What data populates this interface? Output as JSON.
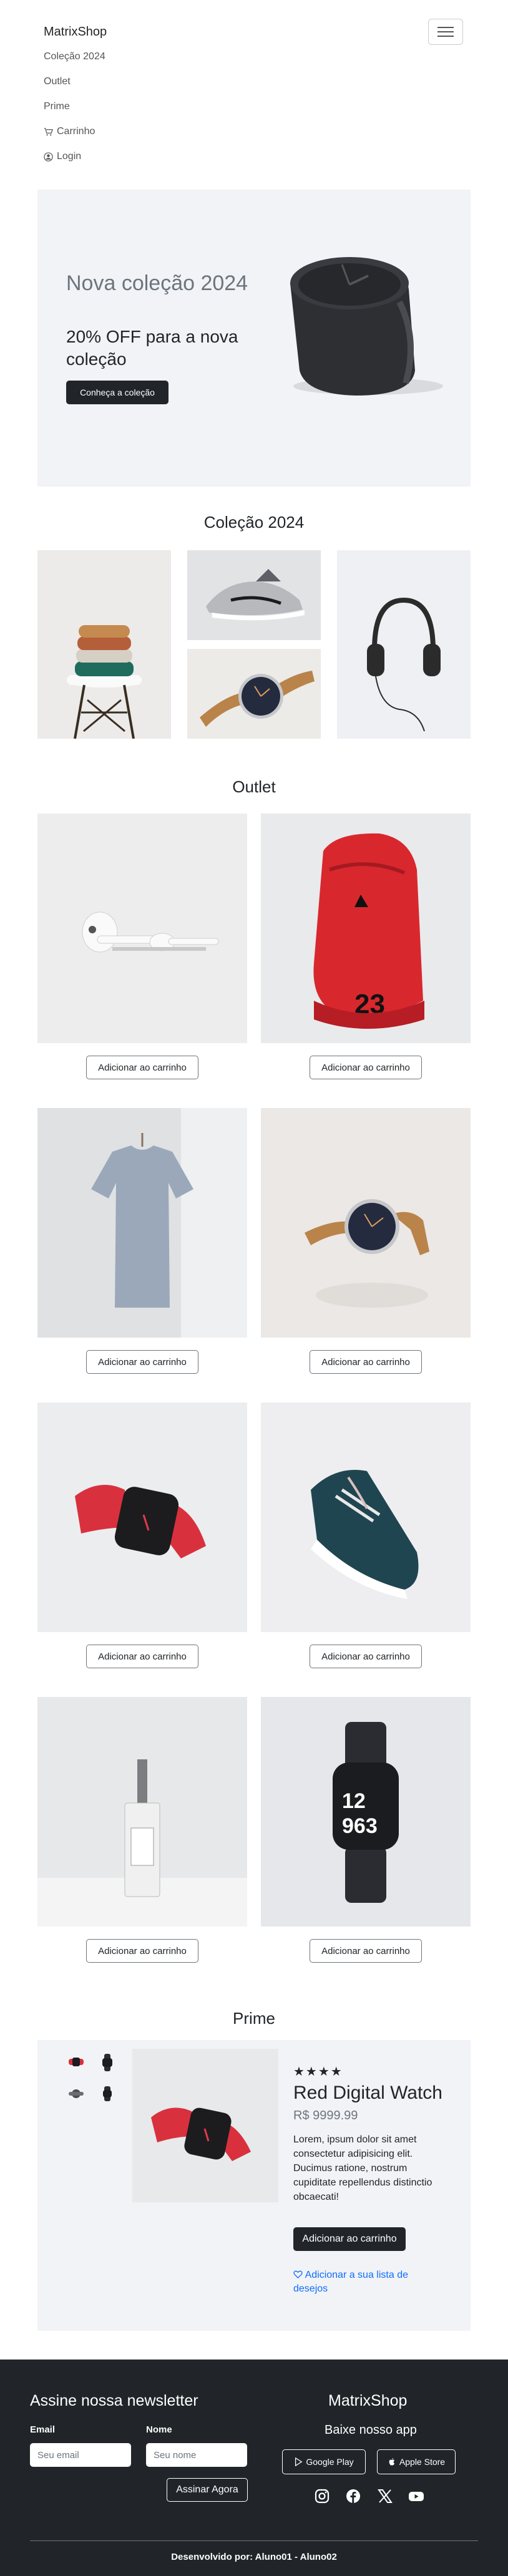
{
  "navbar": {
    "brand": "MatrixShop",
    "items": [
      {
        "label": "Coleção 2024"
      },
      {
        "label": "Outlet"
      },
      {
        "label": "Prime"
      },
      {
        "label": "Carrinho",
        "icon": "cart-icon"
      },
      {
        "label": "Login",
        "icon": "person-circle-icon"
      }
    ]
  },
  "hero": {
    "title": "Nova coleção 2024",
    "subtitle": "20% OFF para a nova coleção",
    "button": "Conheça a coleção"
  },
  "collection": {
    "title": "Coleção 2024"
  },
  "outlet": {
    "title": "Outlet",
    "products": [
      {
        "image": "earbuds",
        "button": "Adicionar ao carrinho"
      },
      {
        "image": "red-sneaker",
        "button": "Adicionar ao carrinho"
      },
      {
        "image": "gray-tshirt",
        "button": "Adicionar ao carrinho"
      },
      {
        "image": "leather-watch",
        "button": "Adicionar ao carrinho"
      },
      {
        "image": "red-smartwatch",
        "button": "Adicionar ao carrinho"
      },
      {
        "image": "teal-sneaker",
        "button": "Adicionar ao carrinho"
      },
      {
        "image": "perfume",
        "button": "Adicionar ao carrinho"
      },
      {
        "image": "black-smartwatch",
        "button": "Adicionar ao carrinho"
      }
    ]
  },
  "prime": {
    "title": "Prime",
    "stars": "★★★★",
    "product_name": "Red Digital Watch",
    "price": "R$ 9999.99",
    "description": "Lorem, ipsum dolor sit amet consectetur adipisicing elit. Ducimus ratione, nostrum cupiditate repellendus distinctio obcaecati!",
    "button": "Adicionar ao carrinho",
    "wishlist": "Adicionar a sua lista de desejos"
  },
  "footer": {
    "newsletter_title": "Assine nossa newsletter",
    "email_label": "Email",
    "email_placeholder": "Seu email",
    "name_label": "Nome",
    "name_placeholder": "Seu nome",
    "subscribe_button": "Assinar Agora",
    "brand": "MatrixShop",
    "app_title": "Baixe nosso app",
    "google_play": "Google Play",
    "apple_store": "Apple Store",
    "credits": "Desenvolvido por: Aluno01 - Aluno02"
  },
  "colors": {
    "dark": "#212529",
    "light_bg": "#f2f3f6",
    "link": "#0d6efd",
    "muted": "#6c757d"
  }
}
